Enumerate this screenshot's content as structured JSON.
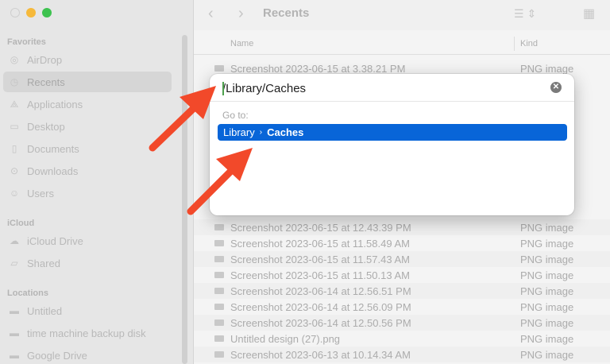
{
  "sidebar": {
    "sections": {
      "favorites": "Favorites",
      "icloud": "iCloud",
      "locations": "Locations"
    },
    "favorites": [
      {
        "label": "AirDrop",
        "icon": "airdrop-icon"
      },
      {
        "label": "Recents",
        "icon": "clock-icon"
      },
      {
        "label": "Applications",
        "icon": "applications-icon"
      },
      {
        "label": "Desktop",
        "icon": "desktop-icon"
      },
      {
        "label": "Documents",
        "icon": "document-icon"
      },
      {
        "label": "Downloads",
        "icon": "download-icon"
      },
      {
        "label": "Users",
        "icon": "user-icon"
      }
    ],
    "icloud": [
      {
        "label": "iCloud Drive",
        "icon": "cloud-icon"
      },
      {
        "label": "Shared",
        "icon": "shared-folder-icon"
      }
    ],
    "locations": [
      {
        "label": "Untitled",
        "icon": "disk-icon"
      },
      {
        "label": "time machine backup disk",
        "icon": "disk-icon"
      },
      {
        "label": "Google Drive",
        "icon": "disk-icon"
      }
    ]
  },
  "toolbar": {
    "title": "Recents",
    "back": "‹",
    "forward": "›"
  },
  "list": {
    "columns": {
      "name": "Name",
      "kind": "Kind"
    },
    "rows": [
      {
        "name": "Screenshot 2023-06-15 at 3.38.21 PM",
        "kind": "PNG image"
      },
      {
        "name": "Screenshot 2023-06-15 at 12.43.39 PM",
        "kind": "PNG image"
      },
      {
        "name": "Screenshot 2023-06-15 at 11.58.49 AM",
        "kind": "PNG image"
      },
      {
        "name": "Screenshot 2023-06-15 at 11.57.43 AM",
        "kind": "PNG image"
      },
      {
        "name": "Screenshot 2023-06-15 at 11.50.13 AM",
        "kind": "PNG image"
      },
      {
        "name": "Screenshot 2023-06-14 at 12.56.51 PM",
        "kind": "PNG image"
      },
      {
        "name": "Screenshot 2023-06-14 at 12.56.09 PM",
        "kind": "PNG image"
      },
      {
        "name": "Screenshot 2023-06-14 at 12.50.56 PM",
        "kind": "PNG image"
      },
      {
        "name": "Untitled design (27).png",
        "kind": "PNG image"
      },
      {
        "name": "Screenshot 2023-06-13 at 10.14.34 AM",
        "kind": "PNG image"
      }
    ]
  },
  "dialog": {
    "path_value": "/Library/Caches",
    "clear_icon": "clear-icon",
    "goto_label": "Go to:",
    "suggestion": {
      "parent": "Library",
      "separator": "›",
      "child": "Caches"
    }
  },
  "colors": {
    "accent": "#0865d8",
    "arrow": "#f2492a",
    "traffic_yellow": "#f6b93b",
    "traffic_green": "#3dc24f"
  }
}
